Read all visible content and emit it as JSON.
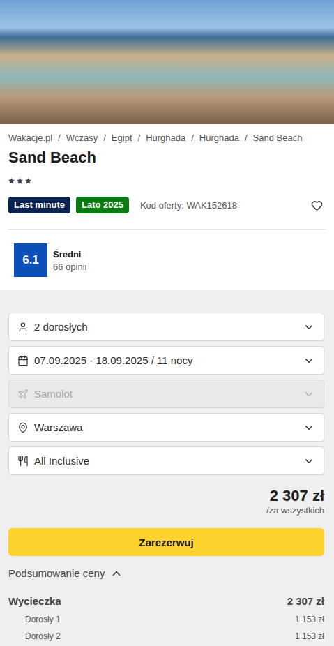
{
  "breadcrumb": [
    "Wakacje.pl",
    "Wczasy",
    "Egipt",
    "Hurghada",
    "Hurghada",
    "Sand Beach"
  ],
  "breadcrumb_separator": "/",
  "title": "Sand Beach",
  "stars": 3,
  "badges": [
    {
      "label": "Last minute",
      "color": "#0b2150"
    },
    {
      "label": "Lato 2025",
      "color": "#0a7d12"
    }
  ],
  "offer_code": "Kod oferty: WAK152618",
  "favorite": false,
  "rating": {
    "score": "6.1",
    "label": "Średni",
    "reviews": "66 opinii"
  },
  "fields": [
    {
      "kind": "travelers",
      "value": "2 dorosłych",
      "disabled": false
    },
    {
      "kind": "dates",
      "value": "07.09.2025 - 18.09.2025 / 11 nocy",
      "disabled": false
    },
    {
      "kind": "transport",
      "value": "Samolot",
      "disabled": true
    },
    {
      "kind": "departure",
      "value": "Warszawa",
      "disabled": false
    },
    {
      "kind": "board",
      "value": "All Inclusive",
      "disabled": false
    }
  ],
  "price": {
    "amount": "2 307 zł",
    "note": "/za wszystkich"
  },
  "book_button": "Zarezerwuj",
  "summary": {
    "title": "Podsumowanie ceny",
    "expanded": true,
    "rows": [
      {
        "label": "Wycieczka",
        "value": "2 307 zł",
        "kind": "total"
      },
      {
        "label": "Dorosły 1",
        "value": "1 153 zł",
        "kind": "item"
      },
      {
        "label": "Dorosły 2",
        "value": "1 153 zł",
        "kind": "item"
      }
    ]
  }
}
